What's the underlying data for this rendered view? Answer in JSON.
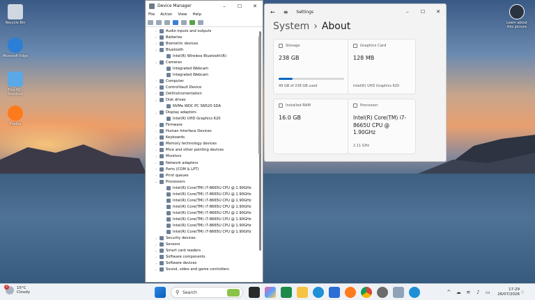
{
  "desktop": {
    "icons_left": [
      {
        "label": "Recycle Bin",
        "icon": "recycle-bin-icon",
        "color": "#cfd8e0"
      },
      {
        "label": "Microsoft Edge",
        "icon": "edge-icon",
        "color": "#2b7fd6"
      },
      {
        "label": "This PC - Shortcut",
        "icon": "this-pc-icon",
        "color": "#5aa9e6"
      },
      {
        "label": "Firefox",
        "icon": "firefox-icon",
        "color": "#ff7a1a"
      }
    ],
    "icon_right": {
      "label": "Learn about this picture",
      "icon": "learn-picture-icon"
    }
  },
  "device_manager": {
    "title": "Device Manager",
    "menu": [
      "File",
      "Action",
      "View",
      "Help"
    ],
    "tree": [
      {
        "label": "Audio inputs and outputs",
        "level": 0,
        "expanded": false
      },
      {
        "label": "Batteries",
        "level": 0,
        "expanded": false
      },
      {
        "label": "Biometric devices",
        "level": 0,
        "expanded": false
      },
      {
        "label": "Bluetooth",
        "level": 0,
        "expanded": true
      },
      {
        "label": "Intel(R) Wireless Bluetooth(R)",
        "level": 1
      },
      {
        "label": "Cameras",
        "level": 0,
        "expanded": true
      },
      {
        "label": "Integrated Webcam",
        "level": 1
      },
      {
        "label": "Integrated Webcam",
        "level": 1
      },
      {
        "label": "Computer",
        "level": 0,
        "expanded": false
      },
      {
        "label": "ControlVault Device",
        "level": 0,
        "expanded": false
      },
      {
        "label": "DellInstrumentation",
        "level": 0,
        "expanded": false
      },
      {
        "label": "Disk drives",
        "level": 0,
        "expanded": true
      },
      {
        "label": "NVMe WDC PC SN520 SDA",
        "level": 1
      },
      {
        "label": "Display adaptors",
        "level": 0,
        "expanded": true
      },
      {
        "label": "Intel(R) UHD Graphics 620",
        "level": 1
      },
      {
        "label": "Firmware",
        "level": 0,
        "expanded": false
      },
      {
        "label": "Human Interface Devices",
        "level": 0,
        "expanded": false
      },
      {
        "label": "Keyboards",
        "level": 0,
        "expanded": false
      },
      {
        "label": "Memory technology devices",
        "level": 0,
        "expanded": false
      },
      {
        "label": "Mice and other pointing devices",
        "level": 0,
        "expanded": false
      },
      {
        "label": "Monitors",
        "level": 0,
        "expanded": false
      },
      {
        "label": "Network adapters",
        "level": 0,
        "expanded": false
      },
      {
        "label": "Ports (COM & LPT)",
        "level": 0,
        "expanded": false
      },
      {
        "label": "Print queues",
        "level": 0,
        "expanded": false
      },
      {
        "label": "Processors",
        "level": 0,
        "expanded": true
      },
      {
        "label": "Intel(R) Core(TM) i7-8665U CPU @ 1.90GHz",
        "level": 1
      },
      {
        "label": "Intel(R) Core(TM) i7-8665U CPU @ 1.90GHz",
        "level": 1
      },
      {
        "label": "Intel(R) Core(TM) i7-8665U CPU @ 1.90GHz",
        "level": 1
      },
      {
        "label": "Intel(R) Core(TM) i7-8665U CPU @ 1.90GHz",
        "level": 1
      },
      {
        "label": "Intel(R) Core(TM) i7-8665U CPU @ 1.90GHz",
        "level": 1
      },
      {
        "label": "Intel(R) Core(TM) i7-8665U CPU @ 1.90GHz",
        "level": 1
      },
      {
        "label": "Intel(R) Core(TM) i7-8665U CPU @ 1.90GHz",
        "level": 1
      },
      {
        "label": "Intel(R) Core(TM) i7-8665U CPU @ 1.90GHz",
        "level": 1
      },
      {
        "label": "Security devices",
        "level": 0,
        "expanded": false
      },
      {
        "label": "Sensors",
        "level": 0,
        "expanded": false
      },
      {
        "label": "Smart card readers",
        "level": 0,
        "expanded": false
      },
      {
        "label": "Software components",
        "level": 0,
        "expanded": false
      },
      {
        "label": "Software devices",
        "level": 0,
        "expanded": false
      },
      {
        "label": "Sound, video and game controllers",
        "level": 0,
        "expanded": false
      }
    ]
  },
  "settings": {
    "title": "Settings",
    "breadcrumb_parent": "System",
    "breadcrumb_sep": "›",
    "page_title": "About",
    "cards": {
      "storage": {
        "label": "Storage",
        "value": "238 GB",
        "sub": "49 GB of 238 GB used",
        "used_fraction": 0.21
      },
      "graphics": {
        "label": "Graphics Card",
        "value": "128 MB",
        "sub": "Intel(R) UHD Graphics 620"
      },
      "ram": {
        "label": "Installed RAM",
        "value": "16.0 GB"
      },
      "processor": {
        "label": "Processor",
        "value": "Intel(R) Core(TM) i7-8665U CPU @ 1.90GHz",
        "sub": "2.11 GHz"
      }
    }
  },
  "taskbar": {
    "weather_temp": "15°C",
    "weather_desc": "Cloudy",
    "weather_badge": "2",
    "search_placeholder": "Search",
    "time": "17:29",
    "date": "26/07/2026"
  },
  "colors": {
    "accent": "#0067c0",
    "storage_bar": "#0067c0"
  }
}
